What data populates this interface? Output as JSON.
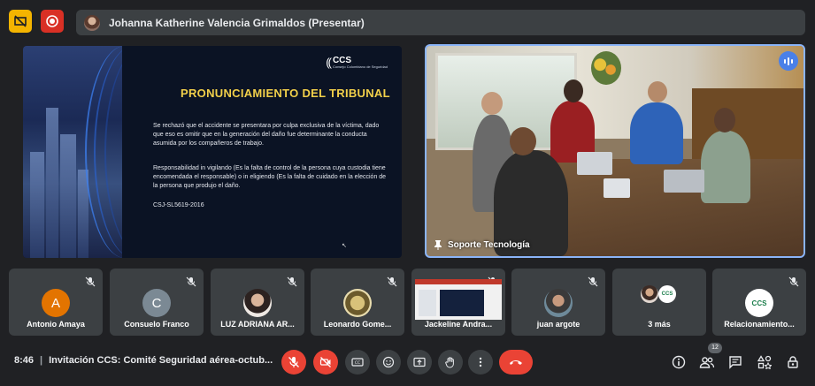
{
  "presenter_bar": {
    "name": "Johanna Katherine Valencia Grimaldos (Presentar)"
  },
  "slide": {
    "logo_abbr": "CCS",
    "logo_sub": "Consejo Colombiano de Seguridad",
    "title": "PRONUNCIAMIENTO DEL TRIBUNAL",
    "paragraph1": "Se rechazó que el accidente se presentara por culpa exclusiva de la víctima, dado que eso es omitir que en la generación del daño fue determinante la conducta asumida por los compañeros de trabajo.",
    "paragraph2": "Responsabilidad in vigilando (Es la falta de control de la persona cuya custodia tiene encomendada el responsable) o in eligiendo (Es la falta de cuidado en la elección de la persona que produjo el daño.",
    "citation": "CSJ-SL5619-2016"
  },
  "camera": {
    "label": "Soporte Tecnología"
  },
  "participants": [
    {
      "name": "Antonio Amaya",
      "initial": "A",
      "color": "#e37400"
    },
    {
      "name": "Consuelo Franco",
      "initial": "C",
      "color": "#7b8994"
    },
    {
      "name": "LUZ ADRIANA AR...",
      "initial": "",
      "color": "#b0a8a4"
    },
    {
      "name": "Leonardo Gome...",
      "initial": "",
      "color": "#8a7a4a"
    },
    {
      "name": "Jackeline Andra...",
      "initial": "",
      "color": "#cccccc"
    },
    {
      "name": "juan argote",
      "initial": "",
      "color": "#556b7a"
    },
    {
      "name": "3 más",
      "initial": "",
      "color": "#ffffff"
    },
    {
      "name": "Relacionamiento...",
      "initial": "",
      "color": "#ffffff"
    }
  ],
  "bottom": {
    "time": "8:46",
    "meeting_title": "Invitación CCS: Comité Seguridad aérea-octub...",
    "people_count": "12"
  },
  "icons": {
    "top_left": "present-off-icon",
    "record": "record-icon",
    "mic": "mic-off-icon",
    "camera": "camera-off-icon",
    "captions": "captions-icon",
    "emoji": "emoji-icon",
    "present": "present-screen-icon",
    "hand": "raise-hand-icon",
    "more": "more-options-icon",
    "hangup": "hang-up-icon",
    "info": "info-icon",
    "people": "people-icon",
    "chat": "chat-icon",
    "activities": "activities-icon",
    "host": "host-controls-icon"
  }
}
